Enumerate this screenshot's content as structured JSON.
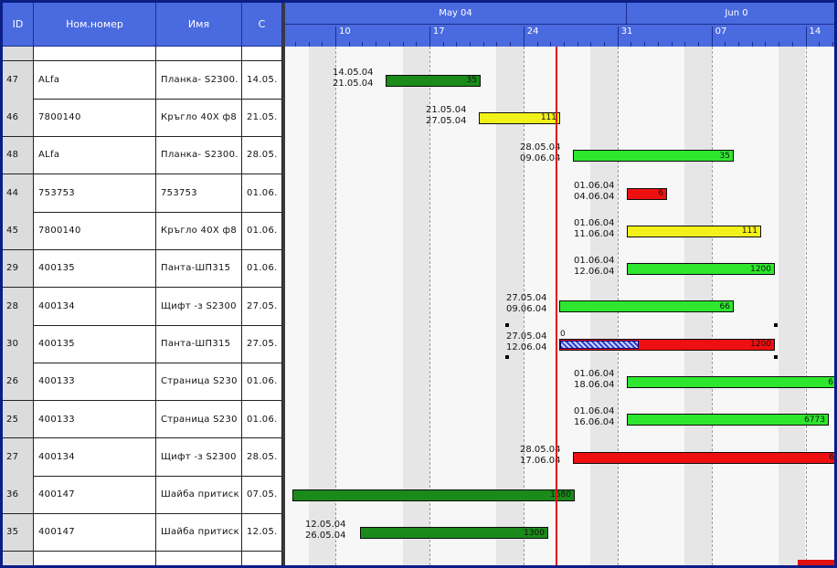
{
  "grid": {
    "headers": {
      "id": "ID",
      "code": "Ном.номер",
      "name": "Имя",
      "c": "С"
    },
    "rows": [
      {
        "id": "47",
        "code": "ALfa",
        "name": "Планка- S2300.",
        "c": "14.05."
      },
      {
        "id": "46",
        "code": "7800140",
        "name": "Кръгло 40X ф8",
        "c": "21.05."
      },
      {
        "id": "48",
        "code": "ALfa",
        "name": "Планка- S2300.",
        "c": "28.05."
      },
      {
        "id": "44",
        "code": "753753",
        "name": "753753",
        "c": "01.06."
      },
      {
        "id": "45",
        "code": "7800140",
        "name": "Кръгло 40X ф8",
        "c": "01.06."
      },
      {
        "id": "29",
        "code": "400135",
        "name": "Панта-ШП315",
        "c": "01.06."
      },
      {
        "id": "28",
        "code": "400134",
        "name": "Щифт -з S2300",
        "c": "27.05."
      },
      {
        "id": "30",
        "code": "400135",
        "name": "Панта-ШП315",
        "c": "27.05."
      },
      {
        "id": "26",
        "code": "400133",
        "name": "Страница S230",
        "c": "01.06."
      },
      {
        "id": "25",
        "code": "400133",
        "name": "Страница S230",
        "c": "01.06."
      },
      {
        "id": "27",
        "code": "400134",
        "name": "Щифт -з S2300",
        "c": "28.05."
      },
      {
        "id": "36",
        "code": "400147",
        "name": "Шайба притиск",
        "c": "07.05."
      },
      {
        "id": "35",
        "code": "400147",
        "name": "Шайба притиск",
        "c": "12.05."
      }
    ]
  },
  "timeline": {
    "months": [
      "May 04",
      "Jun 0"
    ],
    "weeks": [
      "10",
      "17",
      "24",
      "31",
      "07",
      "14"
    ]
  },
  "tasks": [
    {
      "start_label": "14.05.04",
      "end_label": "21.05.04",
      "value": "35",
      "color": "#1a8a1a"
    },
    {
      "start_label": "21.05.04",
      "end_label": "27.05.04",
      "value": "111",
      "color": "#f2f21a"
    },
    {
      "start_label": "28.05.04",
      "end_label": "09.06.04",
      "value": "35",
      "color": "#2ee62e"
    },
    {
      "start_label": "01.06.04",
      "end_label": "04.06.04",
      "value": "6",
      "color": "#ee1010"
    },
    {
      "start_label": "01.06.04",
      "end_label": "11.06.04",
      "value": "111",
      "color": "#f2f21a"
    },
    {
      "start_label": "01.06.04",
      "end_label": "12.06.04",
      "value": "1200",
      "color": "#2ee62e"
    },
    {
      "start_label": "27.05.04",
      "end_label": "09.06.04",
      "value": "66",
      "color": "#2ee62e"
    },
    {
      "start_label": "27.05.04",
      "end_label": "12.06.04",
      "value": "1200",
      "color": "#ee1010",
      "progress_label": "0"
    },
    {
      "start_label": "01.06.04",
      "end_label": "18.06.04",
      "value": "6",
      "color": "#2ee62e"
    },
    {
      "start_label": "01.06.04",
      "end_label": "16.06.04",
      "value": "6773",
      "color": "#2ee62e"
    },
    {
      "start_label": "28.05.04",
      "end_label": "17.06.04",
      "value": "6",
      "color": "#ee1010"
    },
    {
      "start_label": "",
      "end_label": "",
      "value": "1680",
      "color": "#1a8a1a"
    },
    {
      "start_label": "12.05.04",
      "end_label": "26.05.04",
      "value": "1300",
      "color": "#1a8a1a"
    }
  ],
  "colors": {
    "header": "#4a6adf",
    "frame": "#0a1e86",
    "today_line": "#e01010",
    "weekend": "#e6e6e6"
  }
}
